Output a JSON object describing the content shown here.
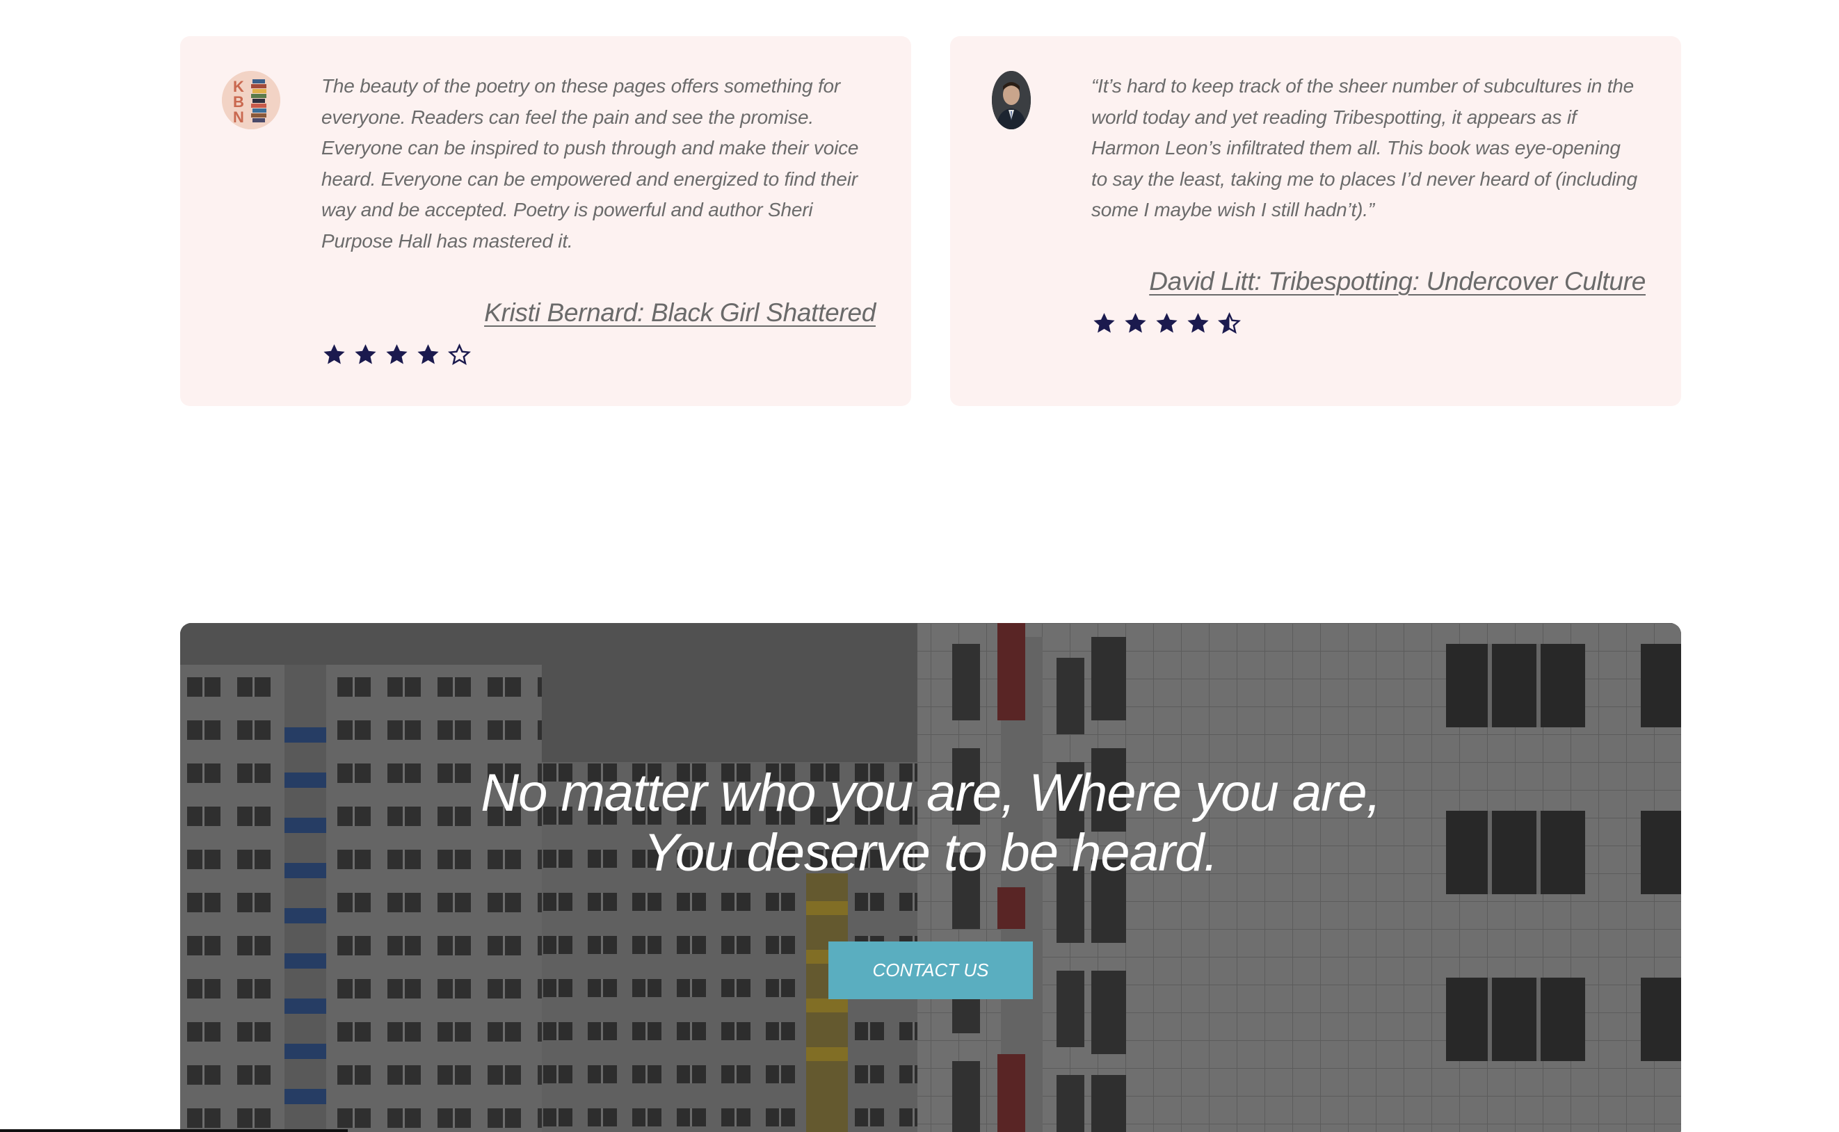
{
  "testimonials": [
    {
      "avatar_icon": "kbn-logo-avatar",
      "quote": "The beauty of the poetry on these pages offers something for everyone. Readers can feel the pain and see the promise. Everyone can be inspired to push through and make their voice heard. Everyone can be empowered and energized to find their way and be accepted. Poetry is powerful and author Sheri Purpose Hall has mastered it.",
      "author_link": "Kristi Bernard: Black Girl Shattered",
      "rating": 4,
      "rating_max": 5
    },
    {
      "avatar_icon": "david-litt-photo-avatar",
      "quote": "“It’s hard to keep track of the sheer number of subcultures in the world today and yet reading Tribespotting, it appears as if Harmon Leon’s infiltrated them all. This book was eye-opening to say the least, taking me to places I’d never heard of (including some I maybe wish I still hadn’t).”",
      "author_link": "David Litt: Tribespotting: Undercover Culture",
      "rating": 4.5,
      "rating_max": 5
    }
  ],
  "cta": {
    "headline_line1": "No matter who you are, Where you are,",
    "headline_line2": "You deserve to be heard.",
    "button_label": "CONTACT US"
  },
  "colors": {
    "card_bg": "#fdf2f1",
    "star": "#1b1a4e",
    "button": "#5aaec0",
    "quote_text": "#6b6b6b"
  }
}
